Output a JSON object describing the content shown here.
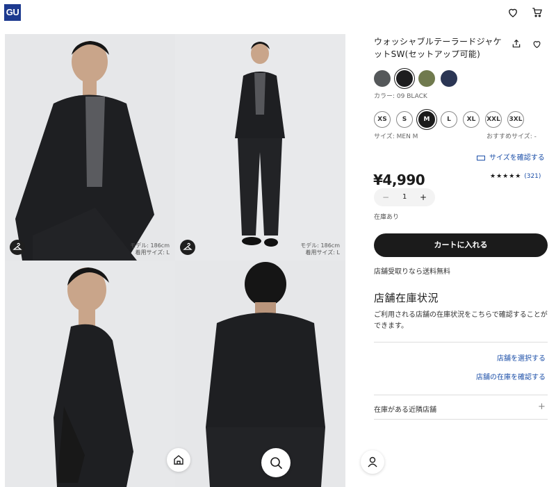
{
  "header": {
    "logo": "GU",
    "icons": [
      "heart-icon",
      "cart-icon"
    ]
  },
  "gallery": {
    "model_note_line1": "モデル: 186cm",
    "model_note_line2": "着用サイズ: L"
  },
  "product": {
    "title": "ウォッシャブルテーラードジャケットSW(セットアップ可能)",
    "color_label": "カラー: 09 BLACK",
    "colors": [
      {
        "name": "gray",
        "hex": "#55585a"
      },
      {
        "name": "black",
        "hex": "#1d1d1f"
      },
      {
        "name": "olive",
        "hex": "#707a4e"
      },
      {
        "name": "navy",
        "hex": "#2b3654"
      }
    ],
    "selected_color_index": 1,
    "sizes": [
      "XS",
      "S",
      "M",
      "L",
      "XL",
      "XXL",
      "3XL"
    ],
    "selected_size": "M",
    "size_label": "サイズ: MEN M",
    "recommended_size": "おすすめサイズ: -",
    "size_check_link": "サイズを確認する",
    "price": "¥4,990",
    "rating_stars": "★★★★★",
    "rating": 4.5,
    "review_count": "(321)",
    "quantity": "1",
    "stock_status": "在庫あり",
    "add_to_cart": "カートに入れる",
    "free_shipping_note": "店舗受取りなら送料無料"
  },
  "store_stock": {
    "heading": "店舗在庫状況",
    "description": "ご利用される店舗の在庫状況をこちらで確認することができます。",
    "select_store_link": "店舗を選択する",
    "check_stock_link": "店舗の在庫を確認する",
    "nearby_stores_label": "在庫がある近隣店舗"
  },
  "colors": {
    "accent_link": "#1c4fa8",
    "button_dark": "#1b1b1b",
    "logo_bg": "#1d3a8f"
  }
}
